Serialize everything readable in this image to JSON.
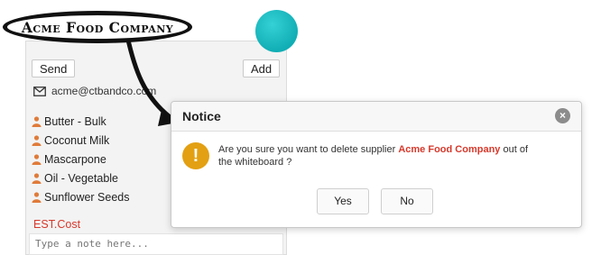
{
  "annotation": {
    "label": "Acme Food Company"
  },
  "card": {
    "send_label": "Send",
    "add_label": "Add",
    "email": "acme@ctbandco.com",
    "items": [
      "Butter - Bulk",
      "Coconut Milk",
      "Mascarpone",
      "Oil - Vegetable",
      "Sunflower Seeds"
    ],
    "est_label": "EST.Cost",
    "note_placeholder": "Type a note here..."
  },
  "dialog": {
    "title": "Notice",
    "close_glyph": "×",
    "warning_glyph": "!",
    "message_before": "Are you sure you want to delete supplier ",
    "supplier": "Acme Food Company",
    "message_after": " out of the whiteboard ?",
    "yes_label": "Yes",
    "no_label": "No"
  },
  "colors": {
    "accent_red": "#d6392b",
    "warning": "#e3a012",
    "teal": "#11aeb5"
  },
  "icons": {
    "email": "envelope-icon",
    "item": "person-icon",
    "close": "close-icon",
    "warning": "exclamation-icon"
  }
}
